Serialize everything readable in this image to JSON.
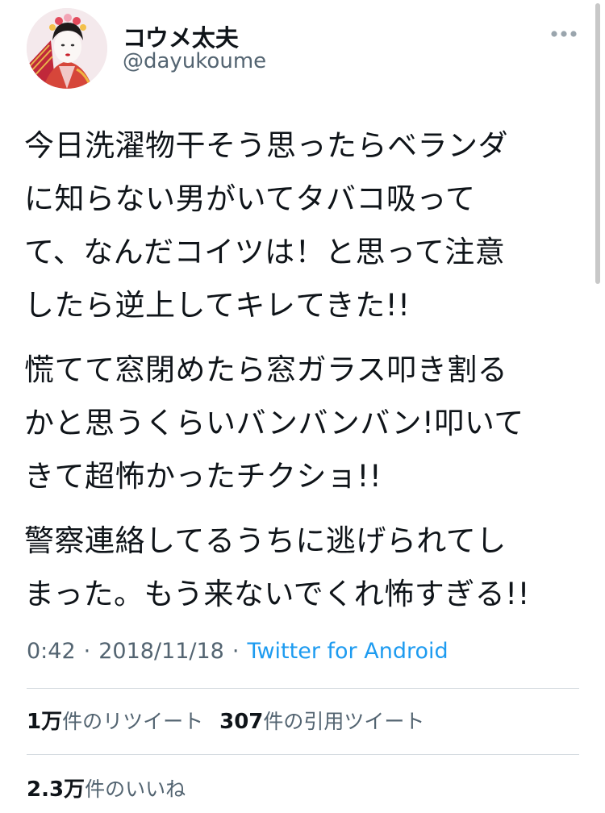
{
  "user": {
    "display_name": "コウメ太夫",
    "handle": "@dayukoume",
    "avatar_icon": "avatar-photo-icon"
  },
  "menu": {
    "more_icon": "more-horizontal-icon"
  },
  "tweet": {
    "paragraphs": [
      "今日洗濯物干そう思ったらベランダ\nに知らない男がいてタバコ吸って\nて、なんだコイツは！と思って注意\nしたら逆上してキレてきた!!",
      "慌てて窓閉めたら窓ガラス叩き割る\nかと思うくらいバンバンバン!叩いて\nきて超怖かったチクショ!!",
      "警察連絡してるうちに逃げられてし\nまった。もう来ないでくれ怖すぎる!!"
    ],
    "time": "0:42",
    "separator": "·",
    "date": "2018/11/18",
    "source": "Twitter for Android"
  },
  "stats": {
    "retweets_count": "1万",
    "retweets_label": "件のリツイート",
    "quotes_count": "307",
    "quotes_label": "件の引用ツイート",
    "likes_count": "2.3万",
    "likes_label": "件のいいね"
  },
  "colors": {
    "text_primary": "#0f1419",
    "text_secondary": "#536471",
    "link": "#1d9bf0",
    "divider": "#d5dbe0"
  }
}
